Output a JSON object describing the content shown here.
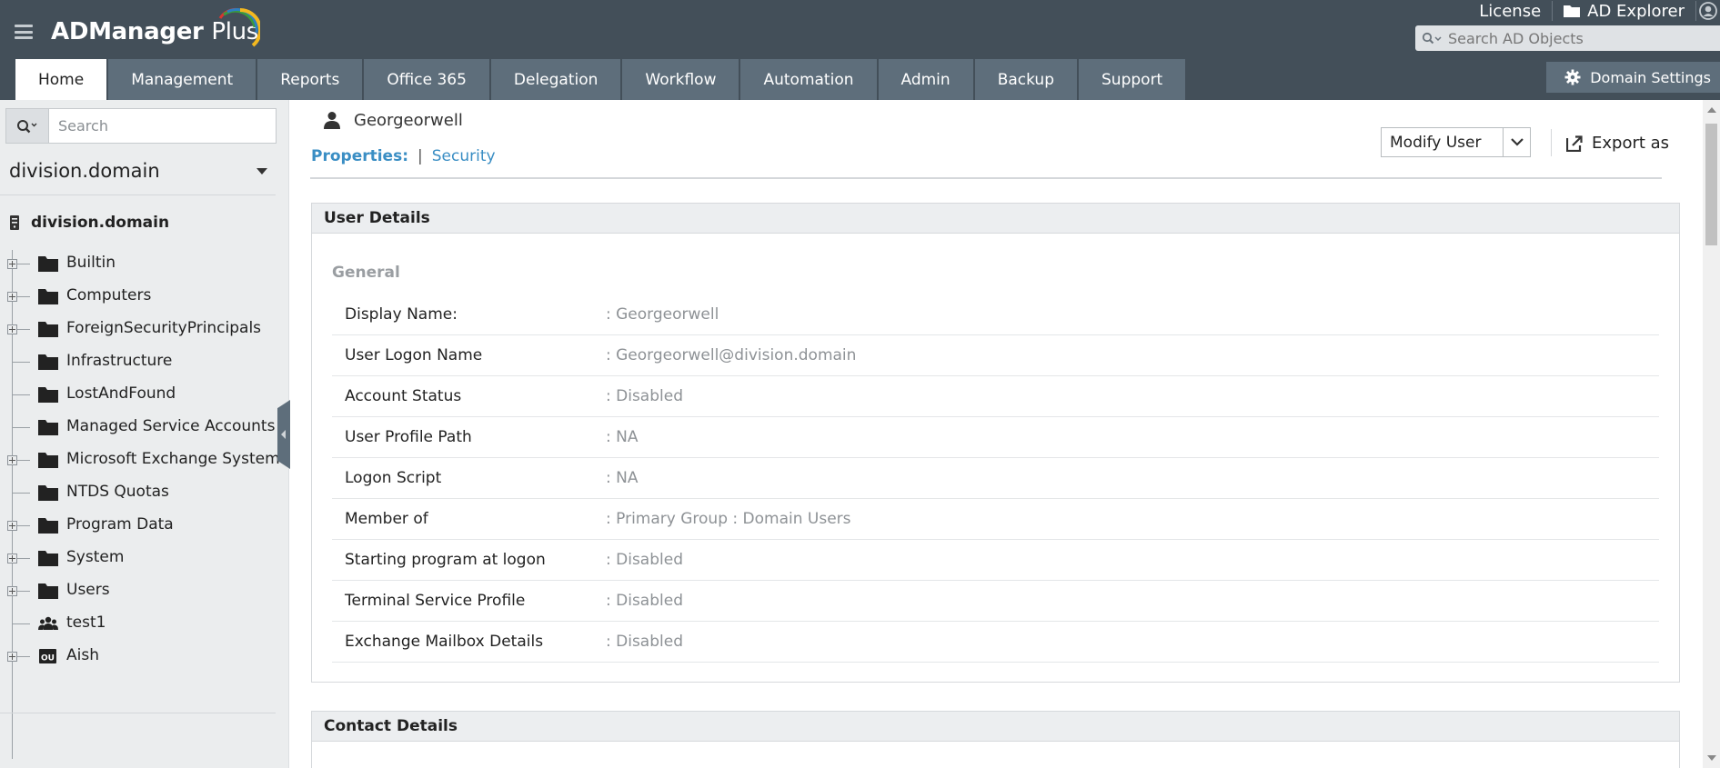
{
  "app": {
    "logo_main": "ADManager",
    "logo_suffix": "Plus"
  },
  "top_links": {
    "license": "License",
    "ad_explorer": "AD Explorer"
  },
  "ad_search": {
    "placeholder": "Search AD Objects"
  },
  "nav": {
    "tabs": [
      {
        "label": "Home",
        "active": true
      },
      {
        "label": "Management"
      },
      {
        "label": "Reports"
      },
      {
        "label": "Office 365"
      },
      {
        "label": "Delegation"
      },
      {
        "label": "Workflow"
      },
      {
        "label": "Automation"
      },
      {
        "label": "Admin"
      },
      {
        "label": "Backup"
      },
      {
        "label": "Support"
      }
    ],
    "domain_settings": "Domain Settings"
  },
  "sidebar": {
    "search_placeholder": "Search",
    "domain_selected": "division.domain",
    "tree_root": "division.domain",
    "items": [
      {
        "label": "Builtin",
        "icon": "folder-icon",
        "expandable": true
      },
      {
        "label": "Computers",
        "icon": "folder-icon",
        "expandable": true
      },
      {
        "label": "ForeignSecurityPrincipals",
        "icon": "folder-icon",
        "expandable": true
      },
      {
        "label": "Infrastructure",
        "icon": "folder-icon",
        "expandable": false
      },
      {
        "label": "LostAndFound",
        "icon": "folder-icon",
        "expandable": false
      },
      {
        "label": "Managed Service Accounts",
        "icon": "folder-icon",
        "expandable": false
      },
      {
        "label": "Microsoft Exchange System",
        "icon": "folder-icon",
        "expandable": true
      },
      {
        "label": "NTDS Quotas",
        "icon": "folder-icon",
        "expandable": false
      },
      {
        "label": "Program Data",
        "icon": "folder-icon",
        "expandable": true
      },
      {
        "label": "System",
        "icon": "folder-icon",
        "expandable": true
      },
      {
        "label": "Users",
        "icon": "folder-icon",
        "expandable": true
      },
      {
        "label": "test1",
        "icon": "group-icon",
        "expandable": false
      },
      {
        "label": "Aish",
        "icon": "ou-icon",
        "expandable": true
      }
    ]
  },
  "main": {
    "object_name": "Georgeorwell",
    "properties_label": "Properties:",
    "separator": "|",
    "security_link": "Security",
    "modify_user": "Modify User",
    "export_as": "Export as",
    "user_details": {
      "title": "User Details",
      "section": "General",
      "rows": [
        {
          "label": "Display Name:",
          "value": ": Georgeorwell"
        },
        {
          "label": "User Logon Name",
          "value": ": Georgeorwell@division.domain"
        },
        {
          "label": "Account Status",
          "value": ": Disabled"
        },
        {
          "label": "User Profile Path",
          "value": ": NA"
        },
        {
          "label": "Logon Script",
          "value": ": NA"
        },
        {
          "label": "Member of",
          "value": ": Primary Group : Domain Users"
        },
        {
          "label": "Starting program at logon",
          "value": ": Disabled"
        },
        {
          "label": "Terminal Service Profile",
          "value": ": Disabled"
        },
        {
          "label": "Exchange Mailbox Details",
          "value": ": Disabled"
        }
      ]
    },
    "contact_details": {
      "title": "Contact Details"
    }
  },
  "colors": {
    "header_bg": "#434f59",
    "tab_bg": "#5e6e7b",
    "link": "#3a8ec4",
    "sidebar_bg": "#ebedee"
  }
}
